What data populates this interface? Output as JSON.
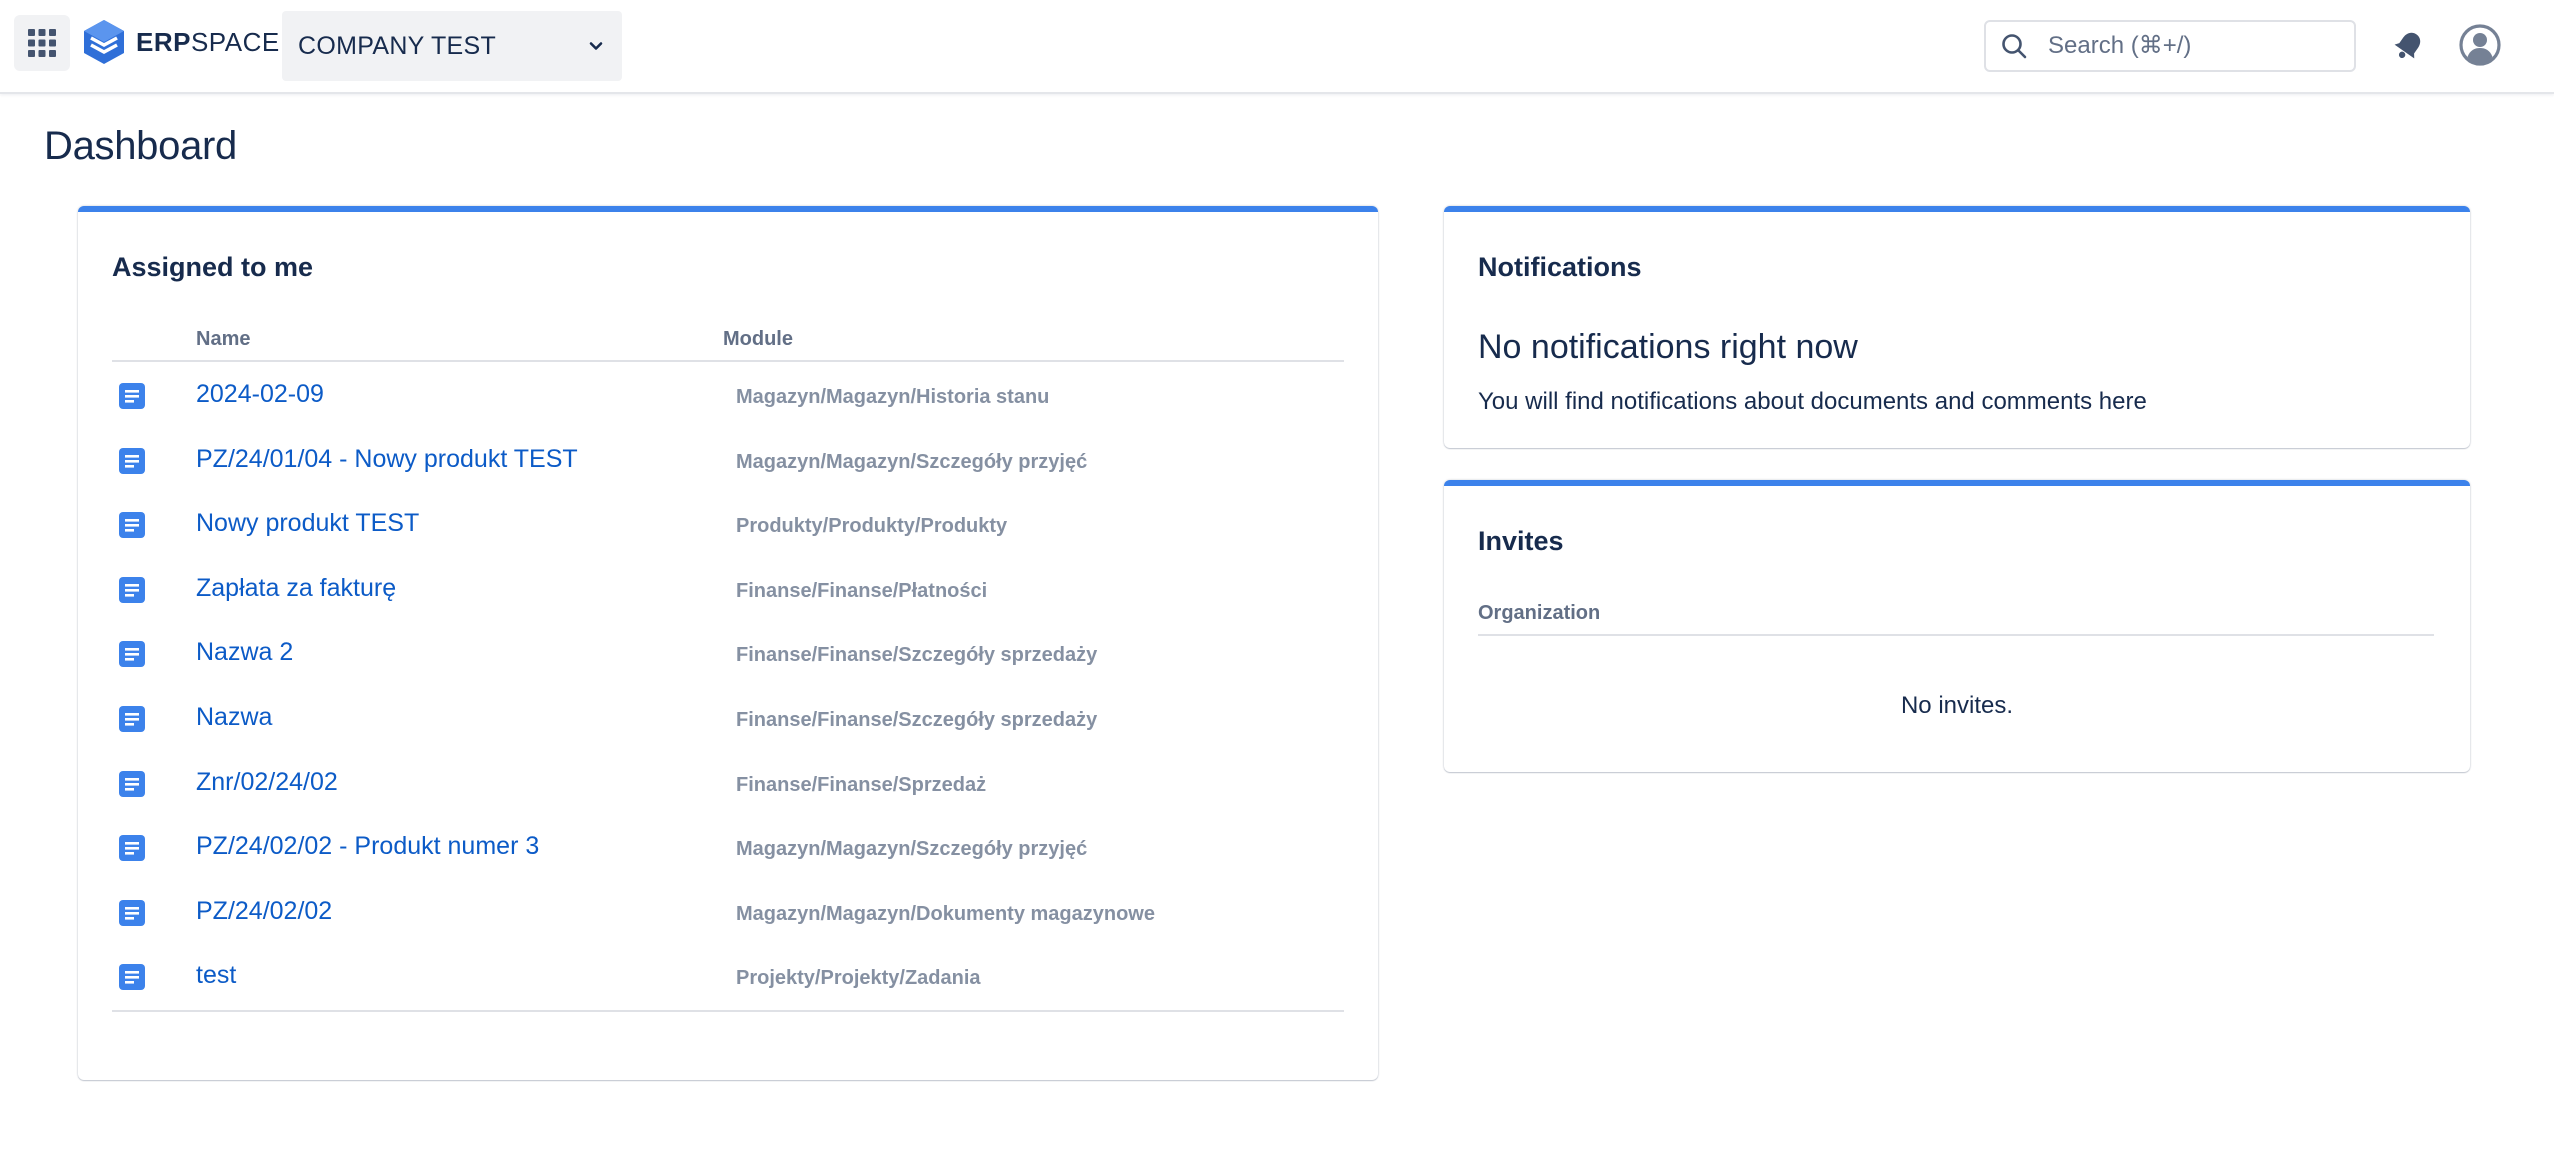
{
  "header": {
    "logo_text_bold": "ERP",
    "logo_text_regular": "SPACE",
    "company": "COMPANY TEST",
    "search_placeholder": "Search (⌘+/)",
    "icons": [
      "app-grid-icon",
      "erpspace-logo-icon",
      "chevron-down-icon",
      "search-icon",
      "notification-icon",
      "user-avatar-icon"
    ]
  },
  "page": {
    "title": "Dashboard"
  },
  "assigned": {
    "title": "Assigned to me",
    "columns": {
      "name": "Name",
      "module": "Module"
    },
    "rows": [
      {
        "name": "2024-02-09",
        "module": "Magazyn/Magazyn/Historia stanu"
      },
      {
        "name": "PZ/24/01/04 - Nowy produkt TEST",
        "module": "Magazyn/Magazyn/Szczegóły przyjęć"
      },
      {
        "name": "Nowy produkt TEST",
        "module": "Produkty/Produkty/Produkty"
      },
      {
        "name": "Zapłata za fakturę",
        "module": "Finanse/Finanse/Płatności"
      },
      {
        "name": "Nazwa 2",
        "module": "Finanse/Finanse/Szczegóły sprzedaży"
      },
      {
        "name": "Nazwa",
        "module": "Finanse/Finanse/Szczegóły sprzedaży"
      },
      {
        "name": "Znr/02/24/02",
        "module": "Finanse/Finanse/Sprzedaż"
      },
      {
        "name": "PZ/24/02/02 - Produkt numer 3",
        "module": "Magazyn/Magazyn/Szczegóły przyjęć"
      },
      {
        "name": "PZ/24/02/02",
        "module": "Magazyn/Magazyn/Dokumenty magazynowe"
      },
      {
        "name": "test",
        "module": "Projekty/Projekty/Zadania"
      }
    ]
  },
  "notifications": {
    "title": "Notifications",
    "heading": "No notifications right now",
    "text": "You will find notifications about documents and comments here"
  },
  "invites": {
    "title": "Invites",
    "column": "Organization",
    "empty": "No invites."
  },
  "colors": {
    "accent": "#3c82eb",
    "link": "#0c5bc7",
    "text": "#172b4d",
    "muted": "#8590a2"
  }
}
